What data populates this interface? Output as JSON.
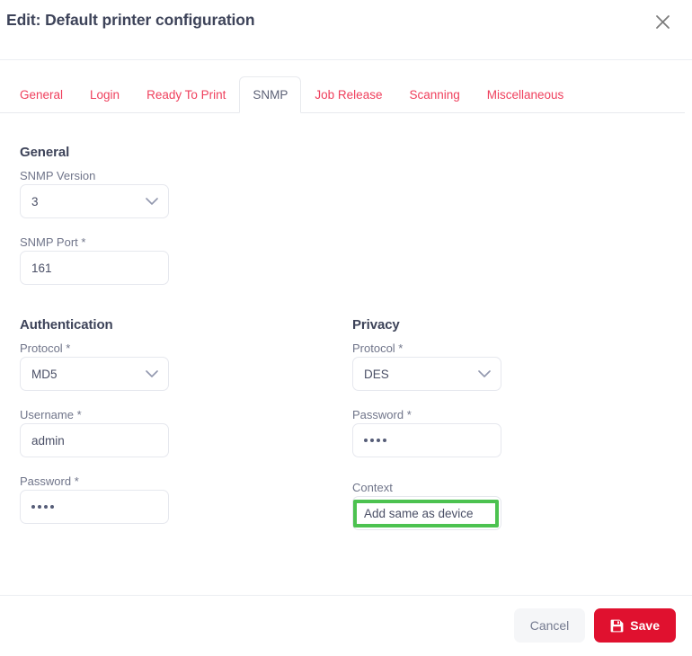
{
  "header": {
    "title": "Edit: Default printer configuration",
    "close_icon": "close-icon"
  },
  "tabs": [
    {
      "label": "General",
      "active": false
    },
    {
      "label": "Login",
      "active": false
    },
    {
      "label": "Ready To Print",
      "active": false
    },
    {
      "label": "SNMP",
      "active": true
    },
    {
      "label": "Job Release",
      "active": false
    },
    {
      "label": "Scanning",
      "active": false
    },
    {
      "label": "Miscellaneous",
      "active": false
    }
  ],
  "sections": {
    "general": {
      "heading": "General",
      "snmp_version": {
        "label": "SNMP Version",
        "value": "3",
        "icon": "chevron-down-icon"
      },
      "snmp_port": {
        "label": "SNMP Port *",
        "value": "161"
      }
    },
    "authentication": {
      "heading": "Authentication",
      "protocol": {
        "label": "Protocol *",
        "value": "MD5",
        "icon": "chevron-down-icon"
      },
      "username": {
        "label": "Username *",
        "value": "admin"
      },
      "password": {
        "label": "Password *",
        "value": "••••",
        "dots": 4
      }
    },
    "privacy": {
      "heading": "Privacy",
      "protocol": {
        "label": "Protocol *",
        "value": "DES",
        "icon": "chevron-down-icon"
      },
      "password": {
        "label": "Password *",
        "value": "••••",
        "dots": 4
      },
      "context": {
        "label": "Context",
        "value": "Add same as device",
        "highlighted": true
      }
    }
  },
  "footer": {
    "cancel_label": "Cancel",
    "save_label": "Save",
    "save_icon": "save-floppy-icon"
  },
  "colors": {
    "accent_red": "#ef3f5c",
    "save_red": "#e0112f",
    "heading": "#3d4359",
    "label": "#70758a",
    "border": "#e6e8ee",
    "highlight_green": "#4cc250"
  }
}
